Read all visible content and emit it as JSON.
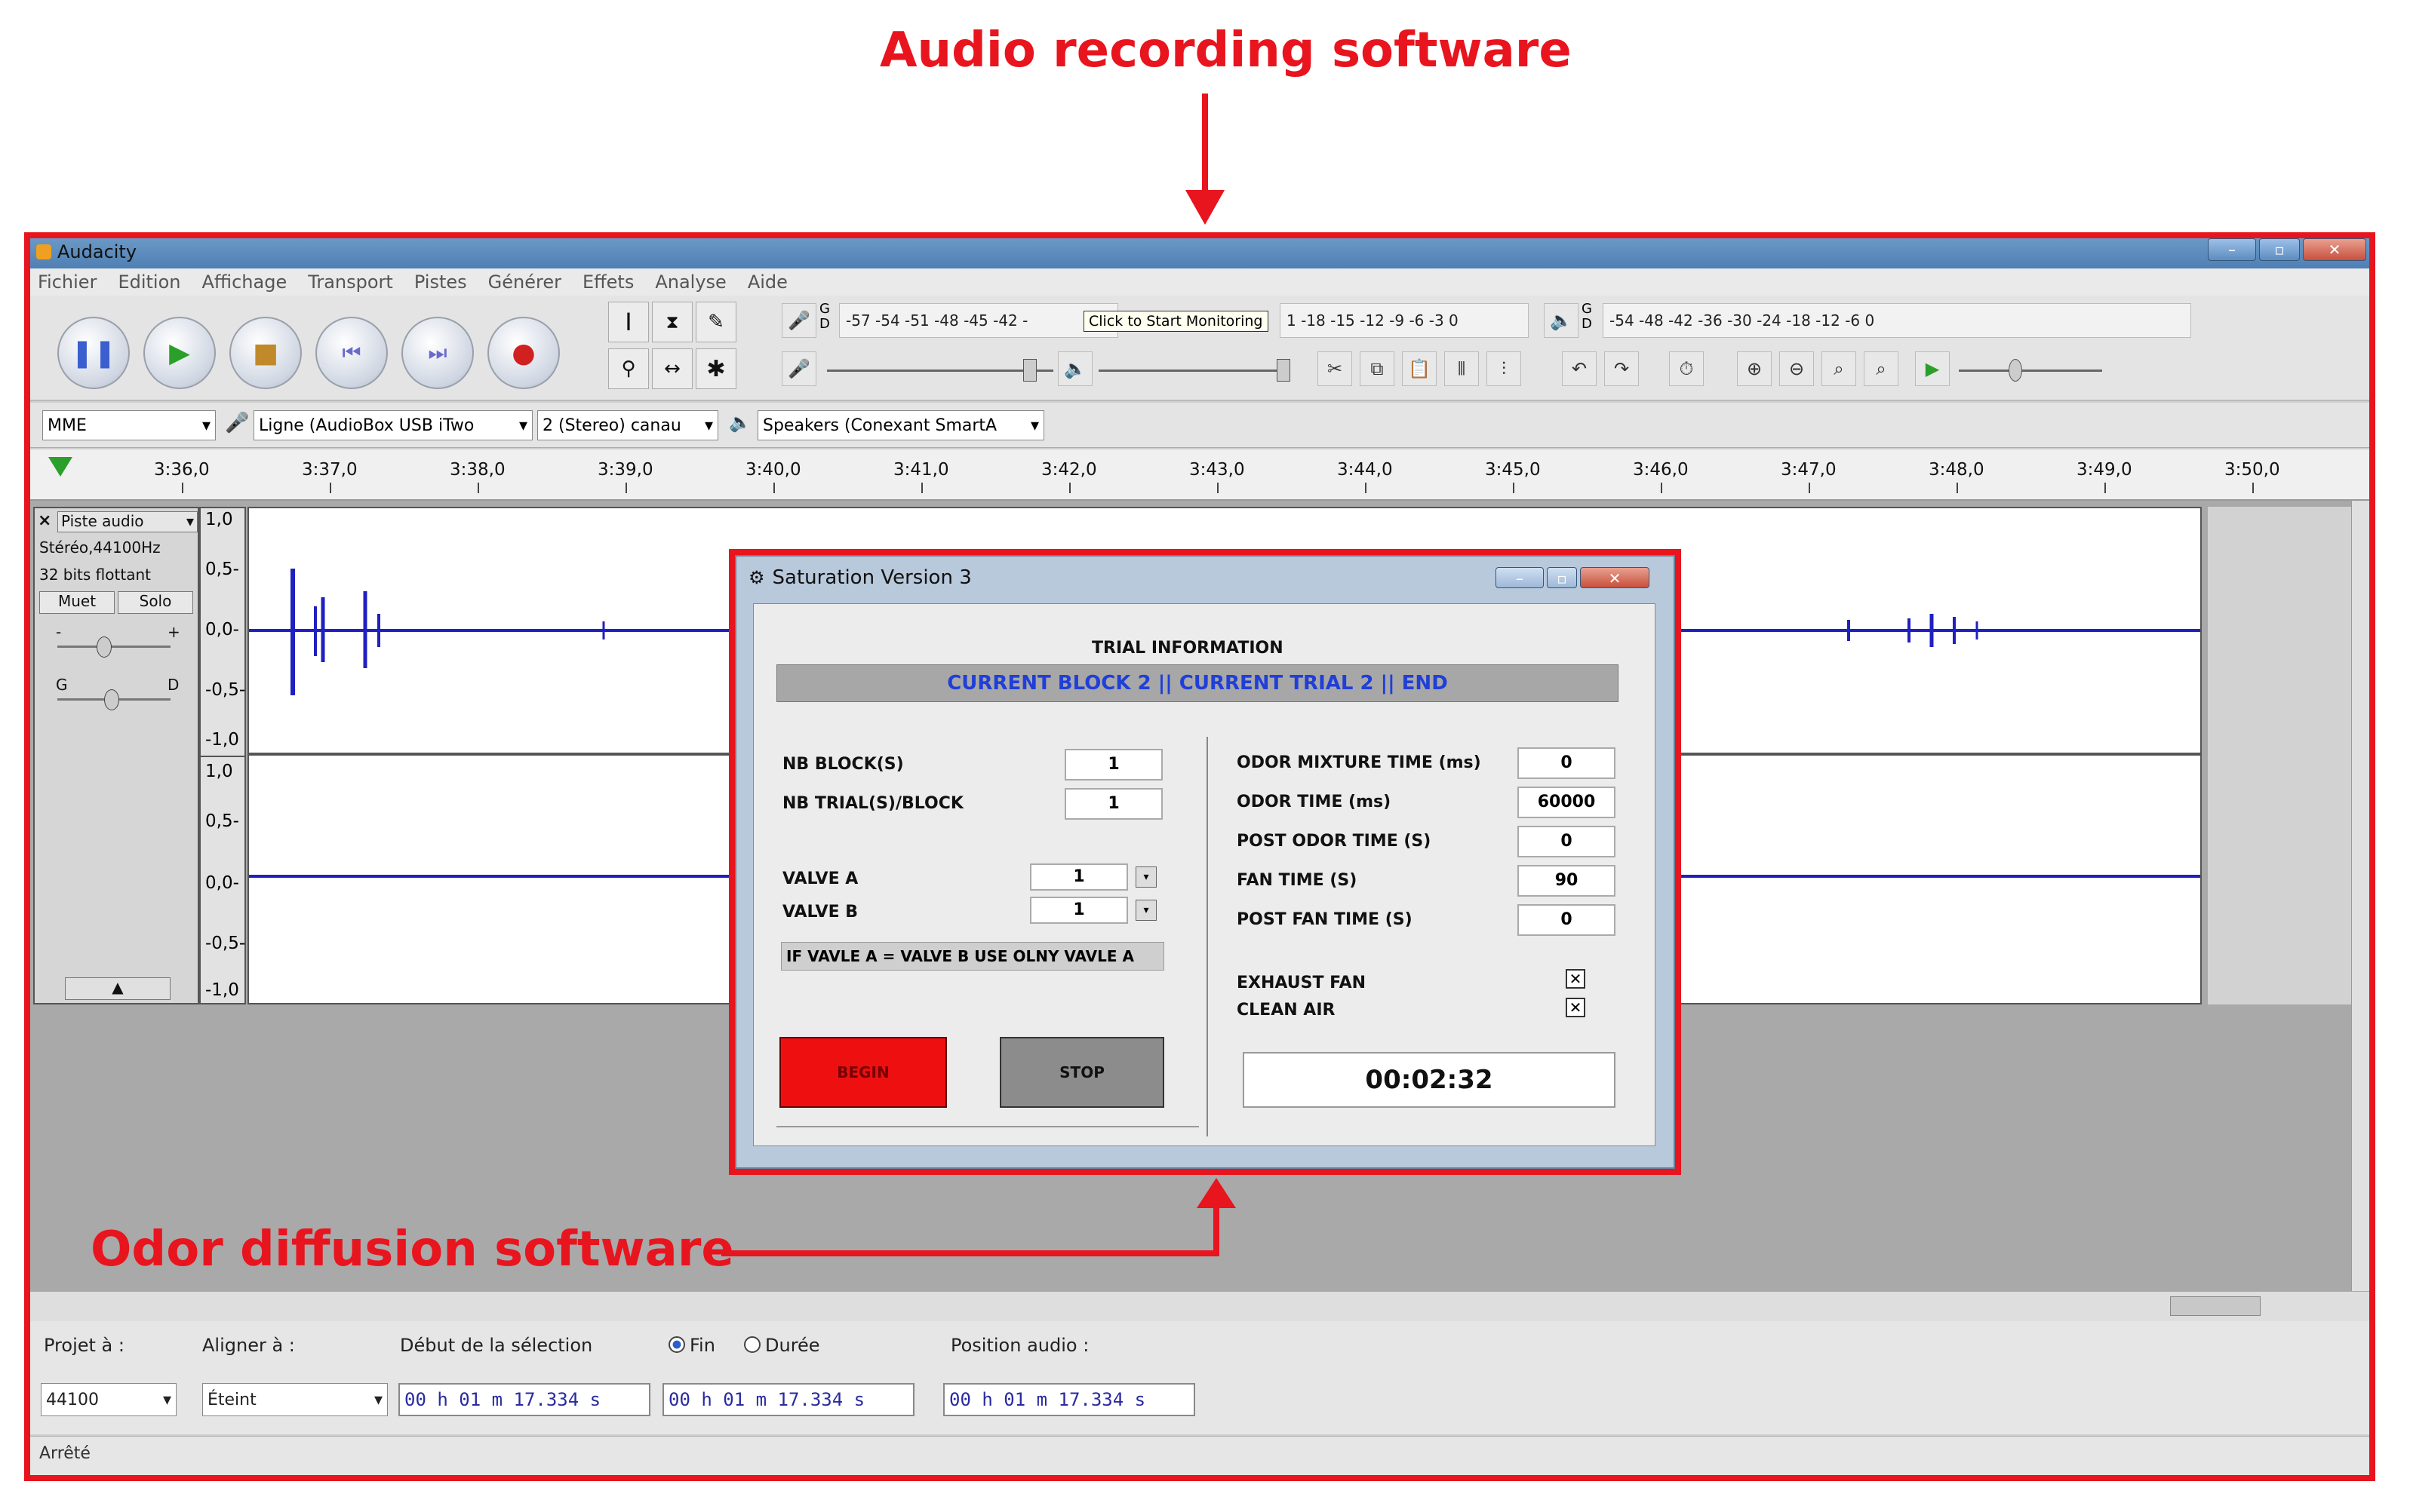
{
  "annotations": {
    "top_label": "Audio recording software",
    "bottom_label": "Odor diffusion software",
    "color": "#e8141e"
  },
  "audacity": {
    "title": "Audacity",
    "menu": [
      "Fichier",
      "Edition",
      "Affichage",
      "Transport",
      "Pistes",
      "Générer",
      "Effets",
      "Analyse",
      "Aide"
    ],
    "transport_icons": [
      "pause-icon",
      "play-icon",
      "stop-icon",
      "skip-start-icon",
      "skip-end-icon",
      "record-icon"
    ],
    "meter_record": {
      "gd": "G\nD",
      "scale": "-57 -54 -51 -48 -45 -42 -",
      "scale_tail": "1 -18 -15 -12 -9 -6 -3 0"
    },
    "meter_play": {
      "gd": "G\nD",
      "scale": "-54   -48   -42   -36   -30   -24   -18   -12   -6   0"
    },
    "monitor_tooltip": "Click to Start Monitoring",
    "device": {
      "host": "MME",
      "input": "Ligne (AudioBox USB iTwo",
      "channels": "2 (Stereo) canau",
      "output": "Speakers (Conexant SmartA"
    },
    "timeline_ticks": [
      "3:36,0",
      "3:37,0",
      "3:38,0",
      "3:39,0",
      "3:40,0",
      "3:41,0",
      "3:42,0",
      "3:43,0",
      "3:44,0",
      "3:45,0",
      "3:46,0",
      "3:47,0",
      "3:48,0",
      "3:49,0",
      "3:50,0"
    ],
    "track": {
      "close": "×",
      "name": "Piste audio",
      "info1": "Stéréo,44100Hz",
      "info2": "32 bits flottant",
      "mute": "Muet",
      "solo": "Solo",
      "gain_minus": "-",
      "gain_plus": "+",
      "pan_left": "G",
      "pan_right": "D",
      "collapse": "▲"
    },
    "scale_labels": [
      "1,0",
      "0,5-",
      "0,0-",
      "-0,5-",
      "-1,0"
    ],
    "selection": {
      "project_rate_label": "Projet à :",
      "project_rate": "44100",
      "snap_label": "Aligner à :",
      "snap_value": "Éteint",
      "start_label": "Début de la sélection",
      "end_label": "Fin",
      "length_label": "Durée",
      "position_label": "Position audio :",
      "start_time": "00 h 01 m 17.334 s",
      "end_time": "00 h 01 m 17.334 s",
      "position_time": "00 h 01 m 17.334 s"
    },
    "status": "Arrêté"
  },
  "dialog": {
    "title": "Saturation Version 3",
    "trial_header": "TRIAL INFORMATION",
    "trial_status": "CURRENT BLOCK 2 || CURRENT TRIAL 2 || END",
    "nb_block_label": "NB BLOCK(S)",
    "nb_block": "1",
    "nb_trial_label": "NB TRIAL(S)/BLOCK",
    "nb_trial": "1",
    "valve_a_label": "VALVE A",
    "valve_a": "1",
    "valve_b_label": "VALVE B",
    "valve_b": "1",
    "valve_note": "IF VAVLE A = VALVE B USE OLNY VAVLE A",
    "begin": "BEGIN",
    "stop": "STOP",
    "odor_mixture_label": "ODOR MIXTURE TIME (ms)",
    "odor_mixture": "0",
    "odor_time_label": "ODOR TIME (ms)",
    "odor_time": "60000",
    "post_odor_label": "POST ODOR TIME (S)",
    "post_odor": "0",
    "fan_time_label": "FAN TIME (S)",
    "fan_time": "90",
    "post_fan_label": "POST FAN TIME (S)",
    "post_fan": "0",
    "exhaust_fan_label": "EXHAUST FAN",
    "clean_air_label": "CLEAN AIR",
    "timer": "00:02:32"
  }
}
